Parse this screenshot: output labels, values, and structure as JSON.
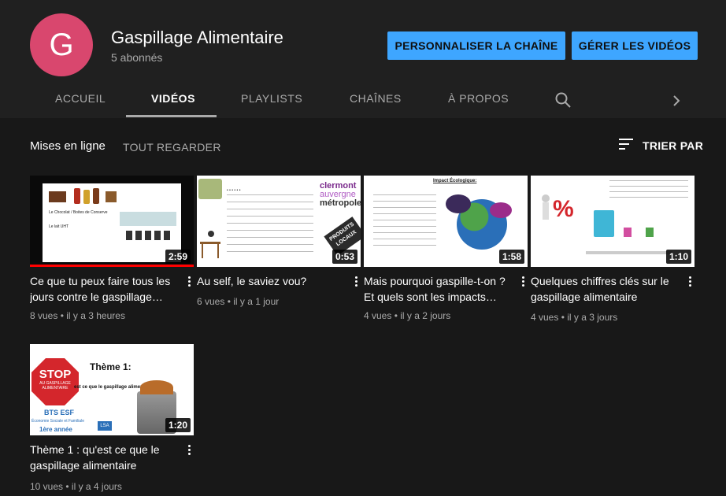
{
  "channel": {
    "avatar_letter": "G",
    "avatar_color": "#d9476e",
    "name": "Gaspillage Alimentaire",
    "subscribers": "5 abonnés"
  },
  "buttons": {
    "customize": "PERSONNALISER LA CHAÎNE",
    "manage": "GÉRER LES VIDÉOS"
  },
  "tabs": [
    {
      "label": "ACCUEIL"
    },
    {
      "label": "VIDÉOS"
    },
    {
      "label": "PLAYLISTS"
    },
    {
      "label": "CHAÎNES"
    },
    {
      "label": "À PROPOS"
    }
  ],
  "active_tab": "VIDÉOS",
  "icons": {
    "search": "search-icon",
    "next": "chevron-right-icon",
    "sort": "sort-icon",
    "more": "more-vert-icon"
  },
  "section": {
    "title": "Mises en ligne",
    "see_all": "TOUT REGARDER",
    "sort_label": "TRIER PAR"
  },
  "videos": [
    {
      "title": "Ce que tu peux faire tous les jours contre le gaspillage…",
      "duration": "2:59",
      "views": "8 vues",
      "age": "il y a 3 heures",
      "watched_fraction": 1.0
    },
    {
      "title": "Au self, le saviez vou?",
      "duration": "0:53",
      "views": "6 vues",
      "age": "il y a 1 jour"
    },
    {
      "title": "Mais pourquoi gaspille-t-on ? Et quels sont les impacts…",
      "duration": "1:58",
      "views": "4 vues",
      "age": "il y a 2 jours"
    },
    {
      "title": "Quelques chiffres clés sur le gaspillage alimentaire",
      "duration": "1:10",
      "views": "4 vues",
      "age": "il y a 3 jours"
    },
    {
      "title": "Thème 1 : qu'est ce que le gaspillage alimentaire",
      "duration": "1:20",
      "views": "10 vues",
      "age": "il y a 4 jours"
    }
  ],
  "thumb_text": {
    "v1_a": "Le Chocolat / Boites de Conserve",
    "v1_b": "Le lait UHT",
    "v2_brand1": "clermont",
    "v2_brand2": "auvergne",
    "v2_brand3": "métropole",
    "v2_sticker": "PRODUITS LOCAUX",
    "v3_heading": "Impact Écologique:",
    "v4_percent": "%",
    "v5_stop": "STOP",
    "v5_stop_sub": "AU GASPILLAGE ALIMENTAIRE",
    "v5_theme": "Thème 1:",
    "v5_question": "est ce que le gaspillage alimentaire ?",
    "v5_bts": "BTS ESF",
    "v5_bts_sub": "Économie Sociale et Familiale",
    "v5_year": "1ère année",
    "v5_logo": "LSA"
  }
}
